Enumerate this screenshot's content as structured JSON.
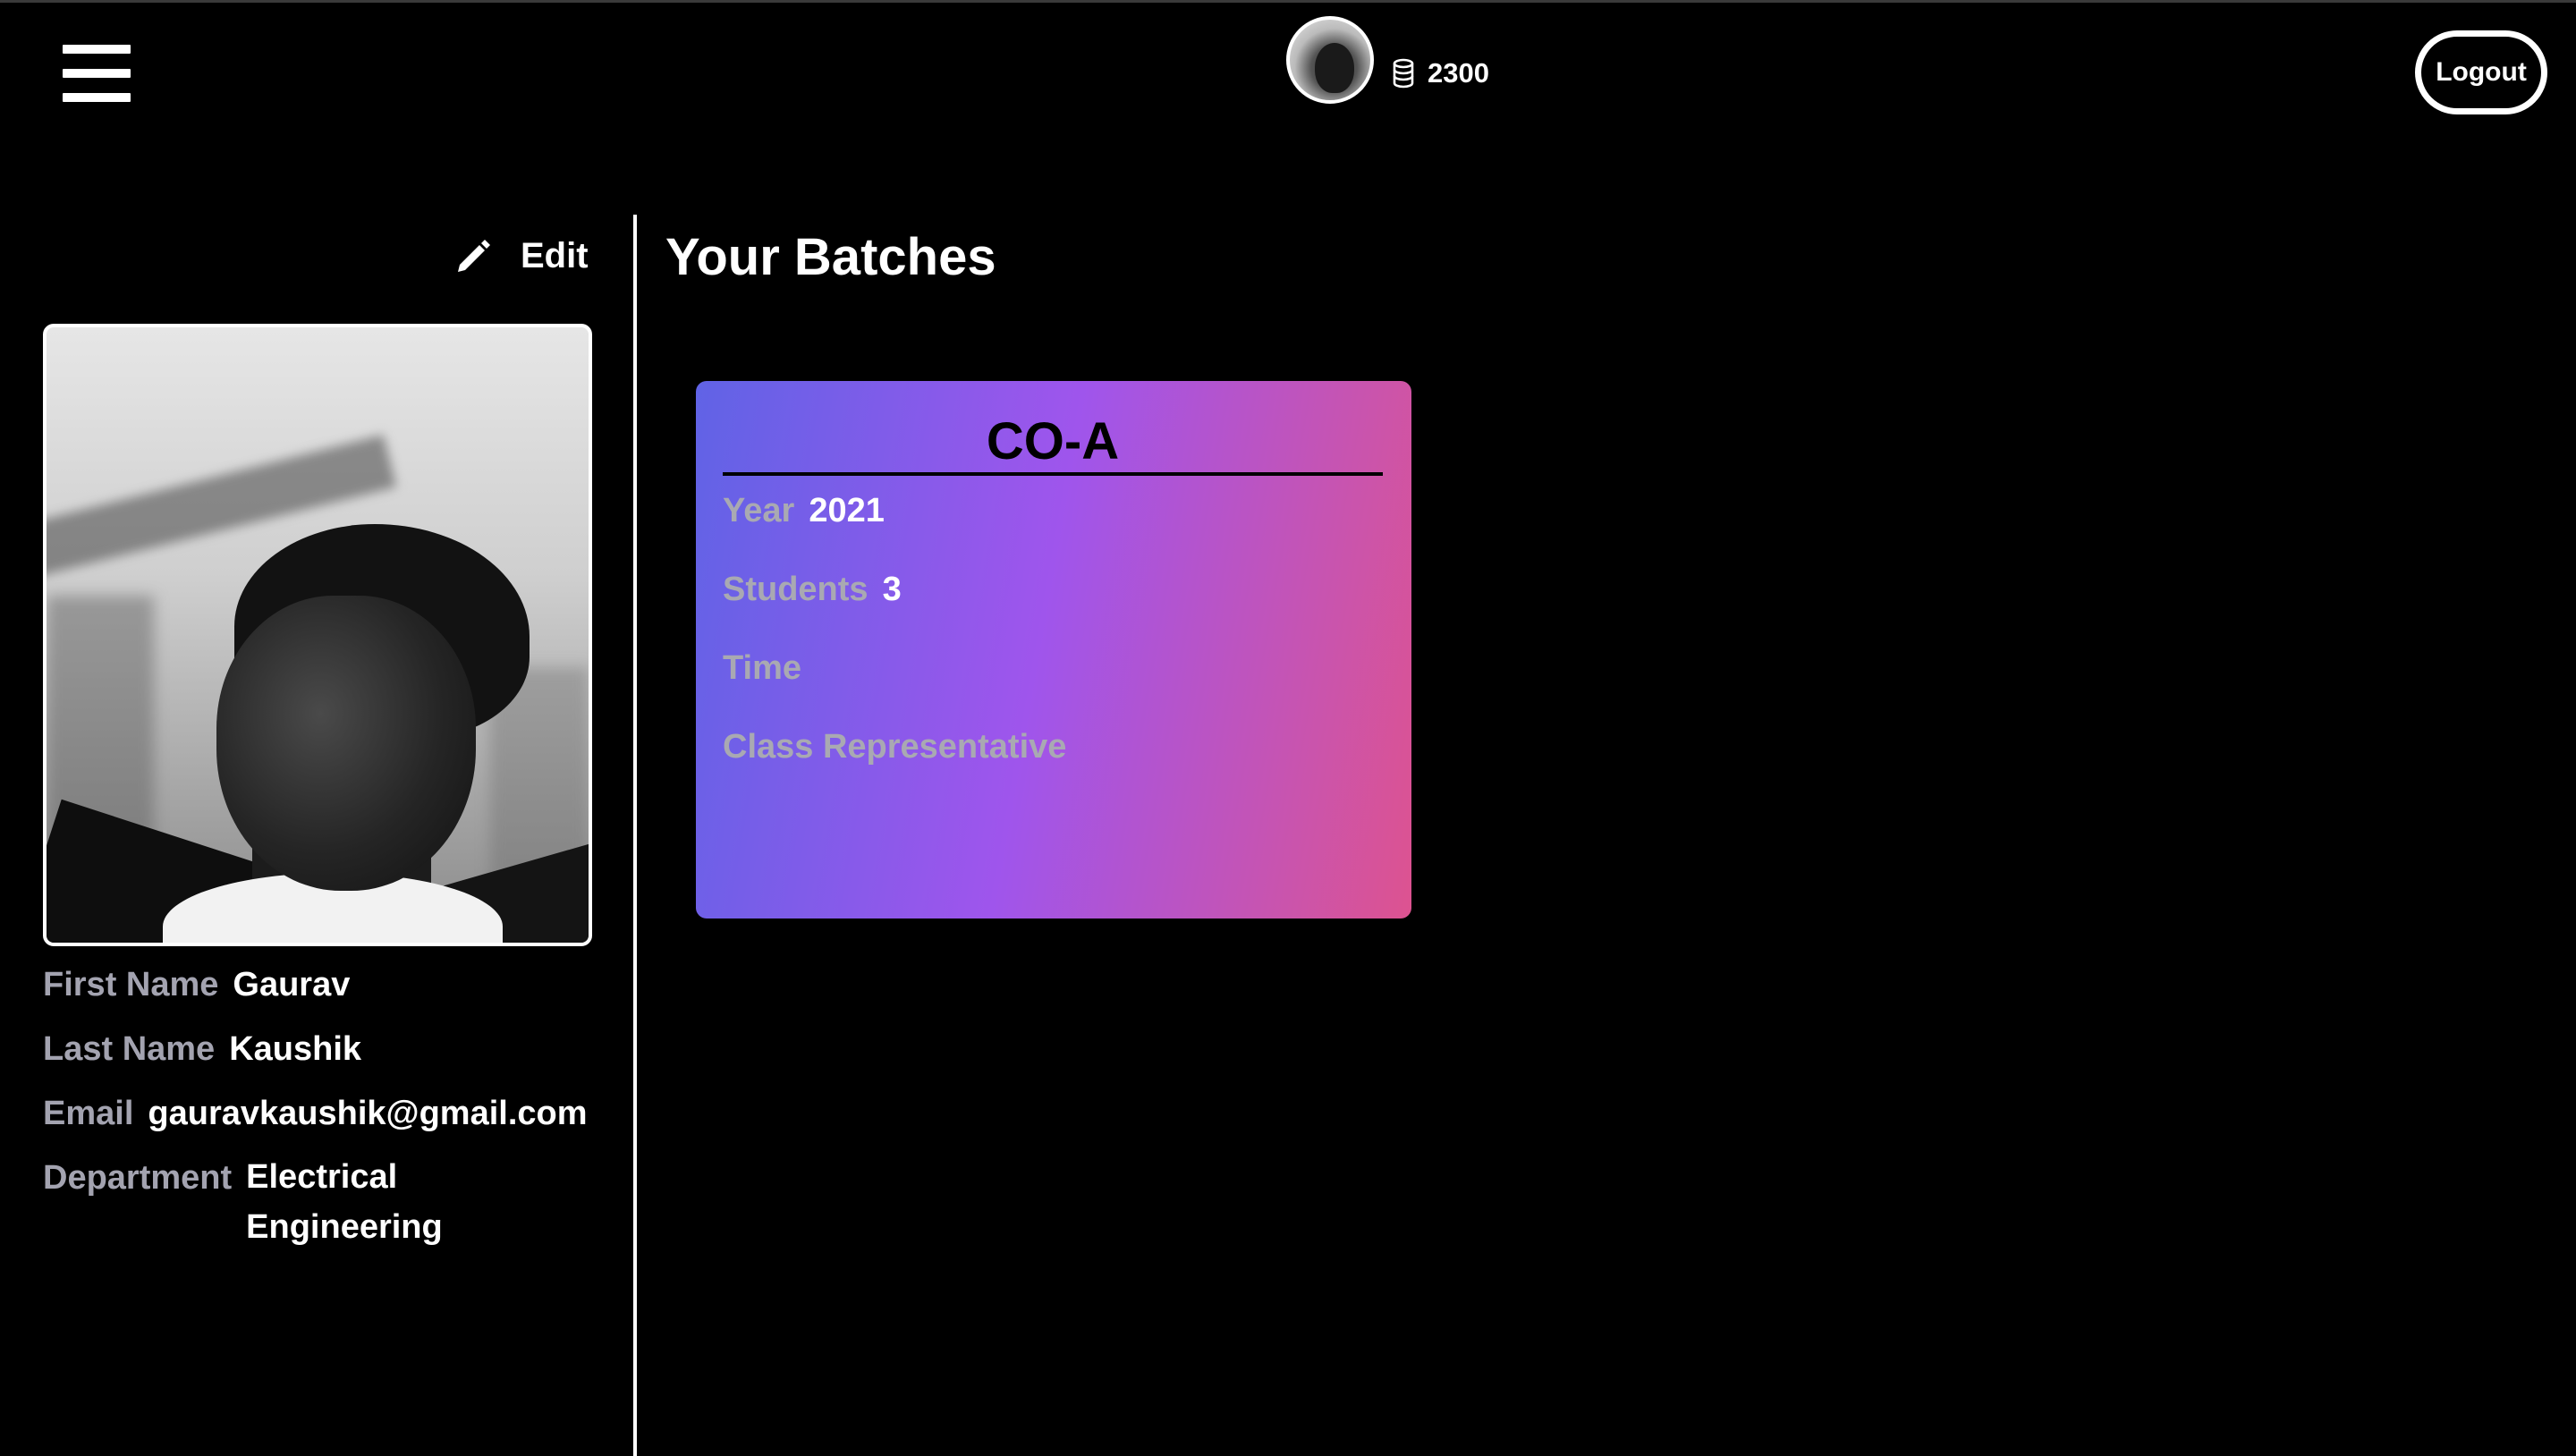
{
  "header": {
    "coins": "2300",
    "logout_label": "Logout"
  },
  "profile": {
    "edit_label": "Edit",
    "fields": [
      {
        "label": "First Name",
        "value": "Gaurav"
      },
      {
        "label": "Last Name",
        "value": "Kaushik"
      },
      {
        "label": "Email",
        "value": "gauravkaushik@gmail.com"
      },
      {
        "label": "Department",
        "value_line1": "Electrical",
        "value_line2": "Engineering"
      }
    ]
  },
  "main": {
    "title": "Your Batches",
    "batches": [
      {
        "name": "CO-A",
        "year_label": "Year",
        "year": "2021",
        "students_label": "Students",
        "students": "3",
        "time_label": "Time",
        "cr_label": "Class Representative"
      }
    ]
  },
  "colors": {
    "background": "#000000",
    "label_gray": "#a3a3b0",
    "card_gradient": [
      "#6063e6",
      "#9f55ec",
      "#dd5390"
    ]
  },
  "icons": [
    "menu-icon",
    "coin-stack-icon",
    "pencil-icon"
  ]
}
